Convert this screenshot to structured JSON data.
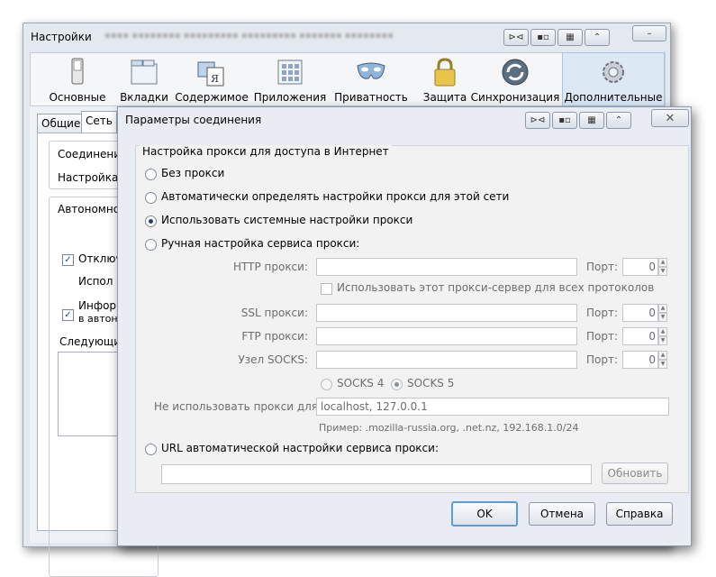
{
  "main_window": {
    "title": "Настройки",
    "toolbar": [
      {
        "label": "Основные",
        "icon": "switch-icon"
      },
      {
        "label": "Вкладки",
        "icon": "tabs-icon"
      },
      {
        "label": "Содержимое",
        "icon": "content-icon"
      },
      {
        "label": "Приложения",
        "icon": "applications-icon"
      },
      {
        "label": "Приватность",
        "icon": "mask-icon"
      },
      {
        "label": "Защита",
        "icon": "padlock-icon"
      },
      {
        "label": "Синхронизация",
        "icon": "sync-icon"
      },
      {
        "label": "Дополнительные",
        "icon": "gear-icon",
        "selected": true
      }
    ],
    "tabs": [
      "Общие",
      "Сеть"
    ],
    "connection_label": "Соединение",
    "proxy_setup_label": "Настройка п",
    "offline_label": "Автономно",
    "disable_cache_label": "Отключ",
    "use_label": "Испол",
    "inform_label_1": "Информ",
    "inform_label_2": "в автоно",
    "following_label": "Следующие"
  },
  "dialog": {
    "title": "Параметры соединения",
    "group_title": "Настройка прокси для доступа в Интернет",
    "options": {
      "no_proxy": "Без прокси",
      "auto_detect": "Автоматически определять настройки прокси для этой сети",
      "system": "Использовать системные настройки прокси",
      "manual": "Ручная настройка сервиса прокси:",
      "auto_url": "URL автоматической настройки сервиса прокси:"
    },
    "selected_option": "system",
    "http_label": "HTTP прокси:",
    "ssl_label": "SSL прокси:",
    "ftp_label": "FTP прокси:",
    "socks_label": "Узел SOCKS:",
    "port_label": "Порт:",
    "port_value": "0",
    "all_protocols_label": "Использовать этот прокси-сервер для всех протоколов",
    "socks4_label": "SOCKS 4",
    "socks5_label": "SOCKS 5",
    "no_proxy_for_label": "Не использовать прокси для:",
    "no_proxy_for_value": "localhost, 127.0.0.1",
    "example_text": "Пример: .mozilla-russia.org, .net.nz, 192.168.1.0/24",
    "reload_button": "Обновить",
    "ok_button": "OK",
    "cancel_button": "Отмена",
    "help_button": "Справка"
  },
  "colors": {
    "selected_toolbar": "#dde8f5",
    "default_button_border": "#5a9ed8",
    "disabled_text": "#6d6d6d"
  }
}
